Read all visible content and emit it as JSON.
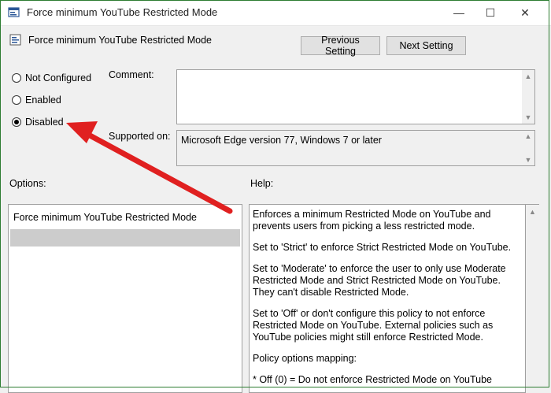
{
  "window": {
    "title": "Force minimum YouTube Restricted Mode",
    "minimize_glyph": "—",
    "maximize_glyph": "☐",
    "close_glyph": "✕"
  },
  "header": {
    "policy_name": "Force minimum YouTube Restricted Mode",
    "prev_label": "Previous Setting",
    "next_label": "Next Setting"
  },
  "state": {
    "options": [
      {
        "label": "Not Configured",
        "selected": false
      },
      {
        "label": "Enabled",
        "selected": false
      },
      {
        "label": "Disabled",
        "selected": true
      }
    ]
  },
  "comment": {
    "label": "Comment:",
    "value": ""
  },
  "supported": {
    "label": "Supported on:",
    "value": "Microsoft Edge version 77, Windows 7 or later"
  },
  "options_panel": {
    "label": "Options:",
    "item": "Force minimum YouTube Restricted Mode"
  },
  "help_panel": {
    "label": "Help:",
    "paragraphs": [
      "Enforces a minimum Restricted Mode on YouTube and prevents users from picking a less restricted mode.",
      "Set to 'Strict' to enforce Strict Restricted Mode on YouTube.",
      "Set to 'Moderate' to enforce the user to only use Moderate Restricted Mode and Strict Restricted Mode on YouTube. They can't disable Restricted Mode.",
      "Set to 'Off' or don't configure this policy to not enforce Restricted Mode on YouTube. External policies such as YouTube policies might still enforce Restricted Mode.",
      "Policy options mapping:",
      "* Off (0) = Do not enforce Restricted Mode on YouTube"
    ]
  },
  "colors": {
    "annotation_arrow": "#e02020",
    "frame_border": "#2e7d32"
  }
}
